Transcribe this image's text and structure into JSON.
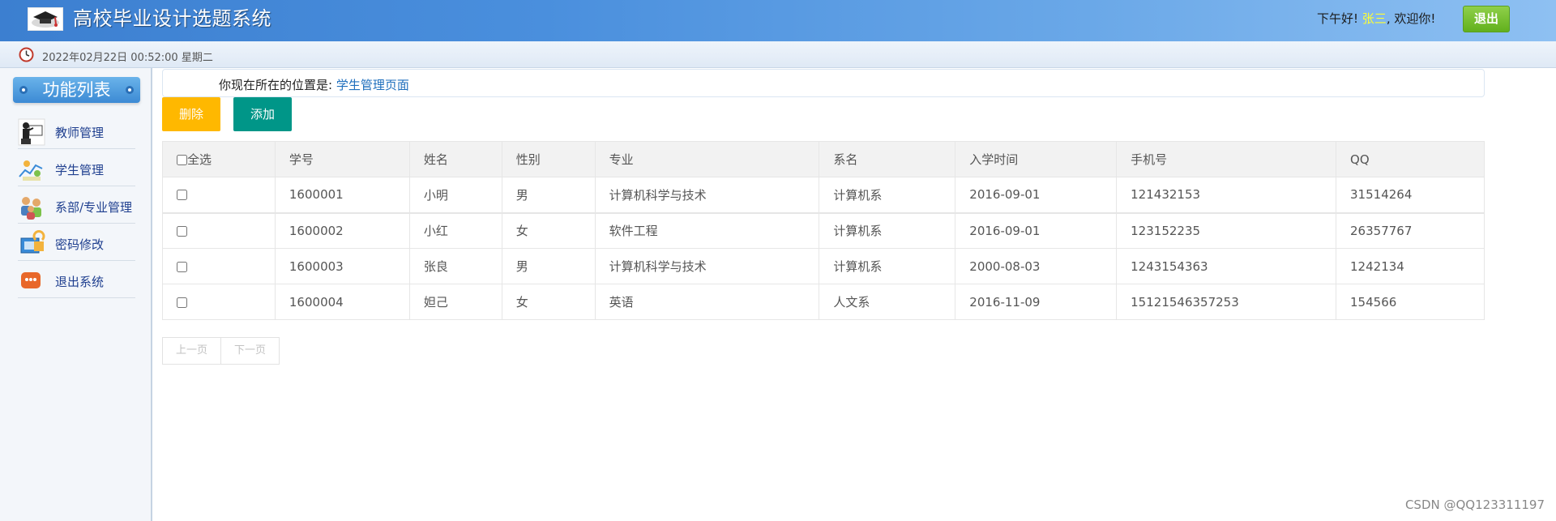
{
  "header": {
    "title": "高校毕业设计选题系统",
    "greeting_prefix": "下午好!",
    "username": "张三",
    "greeting_suffix": ", 欢迎你!",
    "logout_label": "退出"
  },
  "datebar": {
    "datetime": "2022年02月22日 00:52:00 星期二"
  },
  "sidebar": {
    "header": "功能列表",
    "items": [
      {
        "label": "教师管理",
        "icon": "teacher-icon"
      },
      {
        "label": "学生管理",
        "icon": "student-icon"
      },
      {
        "label": "系部/专业管理",
        "icon": "department-icon"
      },
      {
        "label": "密码修改",
        "icon": "password-icon"
      },
      {
        "label": "退出系统",
        "icon": "exit-icon"
      }
    ]
  },
  "breadcrumb": {
    "prefix": "你现在所在的位置是:",
    "current": "学生管理页面"
  },
  "toolbar": {
    "delete_label": "删除",
    "add_label": "添加"
  },
  "table": {
    "select_all_label": "全选",
    "columns": [
      "学号",
      "姓名",
      "性别",
      "专业",
      "系名",
      "入学时间",
      "手机号",
      "QQ"
    ],
    "rows": [
      [
        "1600001",
        "小明",
        "男",
        "计算机科学与技术",
        "计算机系",
        "2016-09-01",
        "121432153",
        "31514264"
      ],
      [
        "1600002",
        "小红",
        "女",
        "软件工程",
        "计算机系",
        "2016-09-01",
        "123152235",
        "26357767"
      ],
      [
        "1600003",
        "张良",
        "男",
        "计算机科学与技术",
        "计算机系",
        "2000-08-03",
        "1243154363",
        "1242134"
      ],
      [
        "1600004",
        "妲己",
        "女",
        "英语",
        "人文系",
        "2016-11-09",
        "15121546357253",
        "154566"
      ]
    ]
  },
  "pager": {
    "prev_label": "上一页",
    "next_label": "下一页"
  },
  "watermark": "CSDN @QQ123311197",
  "colors": {
    "header_blue": "#3c7fd0",
    "delete_yellow": "#ffb800",
    "add_teal": "#009688",
    "logout_green": "#62b01d"
  }
}
